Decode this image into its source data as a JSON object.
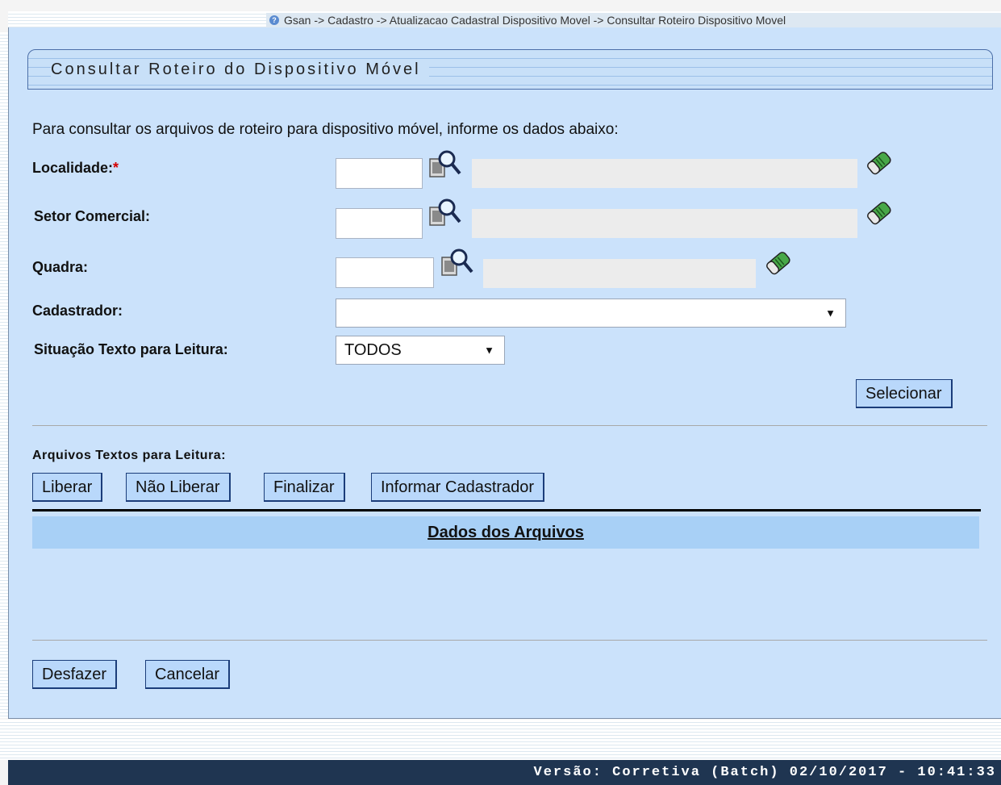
{
  "breadcrumb": "Gsan -> Cadastro -> Atualizacao Cadastral Dispositivo Movel -> Consultar Roteiro Dispositivo Movel",
  "title": "Consultar Roteiro do Dispositivo Móvel",
  "instructions": "Para consultar os arquivos de roteiro para dispositivo móvel, informe os dados abaixo:",
  "form": {
    "localidade": {
      "label": "Localidade:",
      "required_mark": "*",
      "code": "",
      "description": ""
    },
    "setor": {
      "label": "Setor Comercial:",
      "code": "",
      "description": ""
    },
    "quadra": {
      "label": "Quadra:",
      "code": "",
      "description": ""
    },
    "cadastrador": {
      "label": "Cadastrador:",
      "selected": ""
    },
    "situacao": {
      "label": "Situação Texto para Leitura:",
      "selected": "TODOS"
    }
  },
  "buttons": {
    "selecionar": "Selecionar",
    "liberar": "Liberar",
    "nao_liberar": "Não Liberar",
    "finalizar": "Finalizar",
    "informar_cadastrador": "Informar Cadastrador",
    "desfazer": "Desfazer",
    "cancelar": "Cancelar"
  },
  "files": {
    "section_label": "Arquivos Textos para Leitura:",
    "table_header": "Dados dos Arquivos",
    "rows": []
  },
  "footer": "Versão: Corretiva (Batch) 02/10/2017 - 10:41:33",
  "icons": {
    "search": "magnifier-icon",
    "clear": "eraser-icon",
    "help": "help-icon"
  },
  "colors": {
    "panel": "#cbe2fb",
    "table_header": "#a8d0f6",
    "button": "#b9d8fb",
    "footer": "#1f3551"
  }
}
